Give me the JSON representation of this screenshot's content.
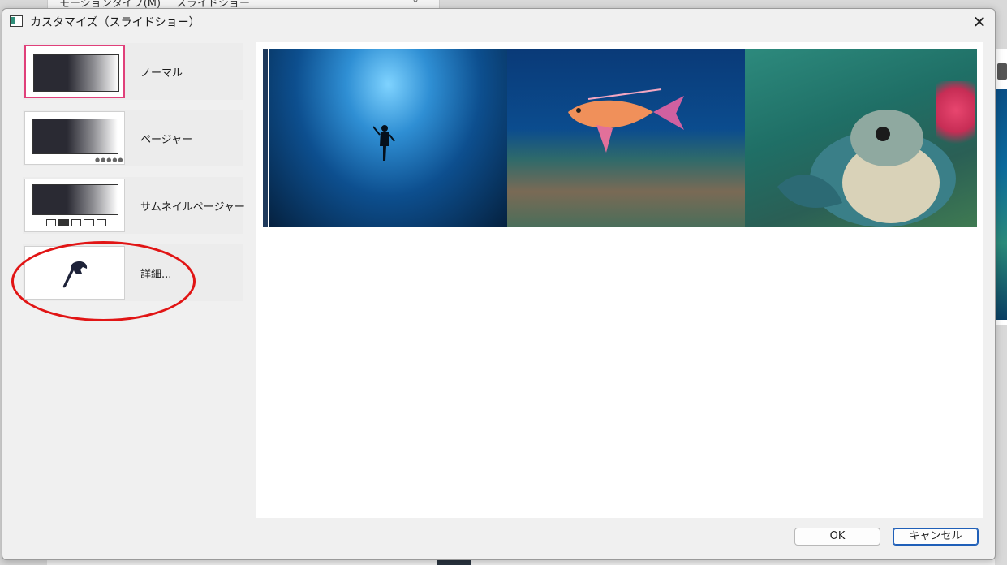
{
  "background_window": {
    "label_1": "モーションタイプ(M)",
    "label_2": "スライドショー"
  },
  "dialog": {
    "title": "カスタマイズ（スライドショー）",
    "close_symbol": "✕"
  },
  "options": [
    {
      "id": "normal",
      "label": "ノーマル",
      "selected": true
    },
    {
      "id": "pager",
      "label": "ページャー",
      "selected": false
    },
    {
      "id": "thumbnail-pager",
      "label": "サムネイルページャー",
      "selected": false
    },
    {
      "id": "details",
      "label": "詳細...",
      "selected": false,
      "icon": "wrench-icon"
    }
  ],
  "preview": {
    "images": [
      "scuba-diver-photo",
      "orange-fish-photo",
      "sea-turtle-photo"
    ]
  },
  "buttons": {
    "ok_label": "OK",
    "cancel_label": "キャンセル"
  },
  "colors": {
    "selected_border": "#e0407a",
    "annotation_red": "#e11515",
    "default_button_border": "#1f5fb8"
  }
}
